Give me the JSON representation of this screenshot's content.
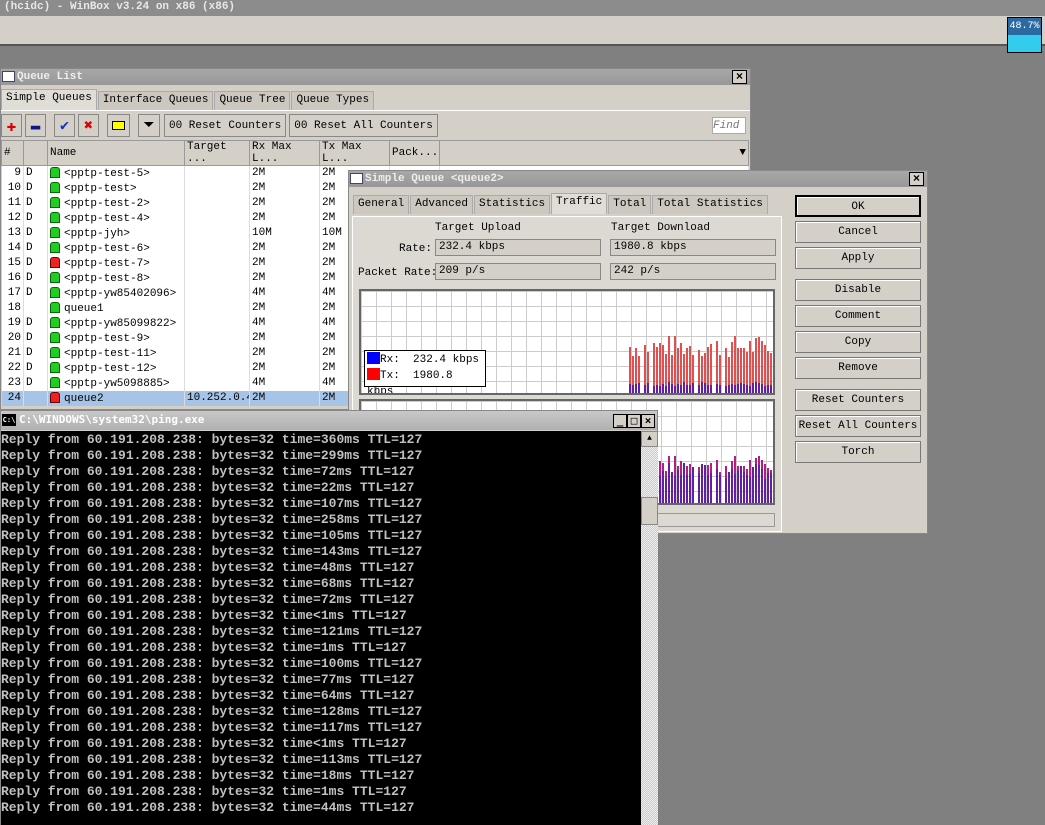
{
  "app": {
    "title": "(hcidc) - WinBox v3.24 on x86 (x86)",
    "cpu": "48.7%"
  },
  "queue_list": {
    "title": "Queue List",
    "tabs": [
      "Simple Queues",
      "Interface Queues",
      "Queue Tree",
      "Queue Types"
    ],
    "toolbar": {
      "reset_counters": "00 Reset Counters",
      "reset_all_counters": "00 Reset All Counters",
      "find_placeholder": "Find"
    },
    "columns": [
      "#",
      "",
      "Name",
      "Target ...",
      "Rx Max L...",
      "Tx Max L...",
      "Pack..."
    ],
    "rows": [
      {
        "n": "9",
        "f": "D",
        "name": "<pptp-test-5>",
        "target": "",
        "rx": "2M",
        "tx": "2M",
        "status": "green"
      },
      {
        "n": "10",
        "f": "D",
        "name": "<pptp-test>",
        "target": "",
        "rx": "2M",
        "tx": "2M",
        "status": "green"
      },
      {
        "n": "11",
        "f": "D",
        "name": "<pptp-test-2>",
        "target": "",
        "rx": "2M",
        "tx": "2M",
        "status": "green"
      },
      {
        "n": "12",
        "f": "D",
        "name": "<pptp-test-4>",
        "target": "",
        "rx": "2M",
        "tx": "2M",
        "status": "green"
      },
      {
        "n": "13",
        "f": "D",
        "name": "<pptp-jyh>",
        "target": "",
        "rx": "10M",
        "tx": "10M",
        "status": "green"
      },
      {
        "n": "14",
        "f": "D",
        "name": "<pptp-test-6>",
        "target": "",
        "rx": "2M",
        "tx": "2M",
        "status": "green"
      },
      {
        "n": "15",
        "f": "D",
        "name": "<pptp-test-7>",
        "target": "",
        "rx": "2M",
        "tx": "2M",
        "status": "red"
      },
      {
        "n": "16",
        "f": "D",
        "name": "<pptp-test-8>",
        "target": "",
        "rx": "2M",
        "tx": "2M",
        "status": "green"
      },
      {
        "n": "17",
        "f": "D",
        "name": "<pptp-yw85402096>",
        "target": "",
        "rx": "4M",
        "tx": "4M",
        "status": "green"
      },
      {
        "n": "18",
        "f": "",
        "name": "queue1",
        "target": "",
        "rx": "2M",
        "tx": "2M",
        "status": "green"
      },
      {
        "n": "19",
        "f": "D",
        "name": "<pptp-yw85099822>",
        "target": "",
        "rx": "4M",
        "tx": "4M",
        "status": "green"
      },
      {
        "n": "20",
        "f": "D",
        "name": "<pptp-test-9>",
        "target": "",
        "rx": "2M",
        "tx": "2M",
        "status": "green"
      },
      {
        "n": "21",
        "f": "D",
        "name": "<pptp-test-11>",
        "target": "",
        "rx": "2M",
        "tx": "2M",
        "status": "green"
      },
      {
        "n": "22",
        "f": "D",
        "name": "<pptp-test-12>",
        "target": "",
        "rx": "2M",
        "tx": "2M",
        "status": "green"
      },
      {
        "n": "23",
        "f": "D",
        "name": "<pptp-yw5098885>",
        "target": "",
        "rx": "4M",
        "tx": "4M",
        "status": "green"
      },
      {
        "n": "24",
        "f": "",
        "name": "queue2",
        "target": "10.252.0.4",
        "rx": "2M",
        "tx": "2M",
        "status": "red",
        "selected": true
      }
    ]
  },
  "simple_queue": {
    "title": "Simple Queue <queue2>",
    "tabs": [
      "General",
      "Advanced",
      "Statistics",
      "Traffic",
      "Total",
      "Total Statistics"
    ],
    "active_tab": "Traffic",
    "target_upload": "Target Upload",
    "target_download": "Target Download",
    "rate_label": "Rate:",
    "packet_rate_label": "Packet Rate:",
    "upload_rate": "232.4 kbps",
    "download_rate": "1980.8 kbps",
    "upload_packet_rate": "209 p/s",
    "download_packet_rate": "242 p/s",
    "legend": {
      "rx_label": "Rx:",
      "rx_value": "232.4 kbps",
      "tx_label": "Tx:",
      "tx_value": "1980.8 kbps",
      "rx_color": "#0000ff",
      "tx_color": "#ff0000"
    },
    "buttons": [
      "OK",
      "Cancel",
      "Apply",
      "Disable",
      "Comment",
      "Copy",
      "Remove",
      "Reset Counters",
      "Reset All Counters",
      "Torch"
    ]
  },
  "ping": {
    "title": "C:\\WINDOWS\\system32\\ping.exe",
    "lines": [
      "Reply from 60.191.208.238: bytes=32 time=360ms TTL=127",
      "Reply from 60.191.208.238: bytes=32 time=299ms TTL=127",
      "Reply from 60.191.208.238: bytes=32 time=72ms TTL=127",
      "Reply from 60.191.208.238: bytes=32 time=22ms TTL=127",
      "Reply from 60.191.208.238: bytes=32 time=107ms TTL=127",
      "Reply from 60.191.208.238: bytes=32 time=258ms TTL=127",
      "Reply from 60.191.208.238: bytes=32 time=105ms TTL=127",
      "Reply from 60.191.208.238: bytes=32 time=143ms TTL=127",
      "Reply from 60.191.208.238: bytes=32 time=48ms TTL=127",
      "Reply from 60.191.208.238: bytes=32 time=68ms TTL=127",
      "Reply from 60.191.208.238: bytes=32 time=72ms TTL=127",
      "Reply from 60.191.208.238: bytes=32 time<1ms TTL=127",
      "Reply from 60.191.208.238: bytes=32 time=121ms TTL=127",
      "Reply from 60.191.208.238: bytes=32 time=1ms TTL=127",
      "Reply from 60.191.208.238: bytes=32 time=100ms TTL=127",
      "Reply from 60.191.208.238: bytes=32 time=77ms TTL=127",
      "Reply from 60.191.208.238: bytes=32 time=64ms TTL=127",
      "Reply from 60.191.208.238: bytes=32 time=128ms TTL=127",
      "Reply from 60.191.208.238: bytes=32 time=117ms TTL=127",
      "Reply from 60.191.208.238: bytes=32 time<1ms TTL=127",
      "Reply from 60.191.208.238: bytes=32 time=113ms TTL=127",
      "Reply from 60.191.208.238: bytes=32 time=18ms TTL=127",
      "Reply from 60.191.208.238: bytes=32 time=1ms TTL=127",
      "Reply from 60.191.208.238: bytes=32 time=44ms TTL=127"
    ]
  }
}
